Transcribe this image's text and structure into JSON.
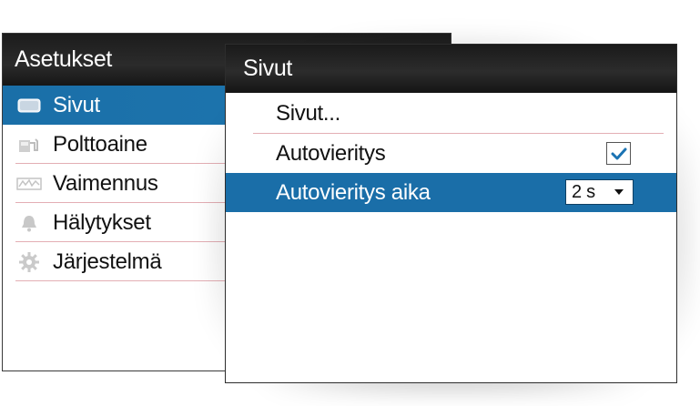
{
  "settings": {
    "title": "Asetukset",
    "items": [
      {
        "label": "Sivut",
        "icon": "pages-icon",
        "selected": true
      },
      {
        "label": "Polttoaine",
        "icon": "fuel-icon",
        "selected": false
      },
      {
        "label": "Vaimennus",
        "icon": "damping-icon",
        "selected": false
      },
      {
        "label": "Hälytykset",
        "icon": "bell-icon",
        "selected": false
      },
      {
        "label": "Järjestelmä",
        "icon": "gear-icon",
        "selected": false
      }
    ]
  },
  "popup": {
    "title": "Sivut",
    "items": [
      {
        "label": "Sivut..."
      },
      {
        "label": "Autovieritys",
        "checked": true
      },
      {
        "label": "Autovieritys aika",
        "value": "2 s",
        "highlighted": true
      }
    ]
  },
  "colors": {
    "selection": "#1a6ea8",
    "header": "#1f1f1f",
    "divider": "#e3aeb4",
    "check": "#1b73b3"
  }
}
